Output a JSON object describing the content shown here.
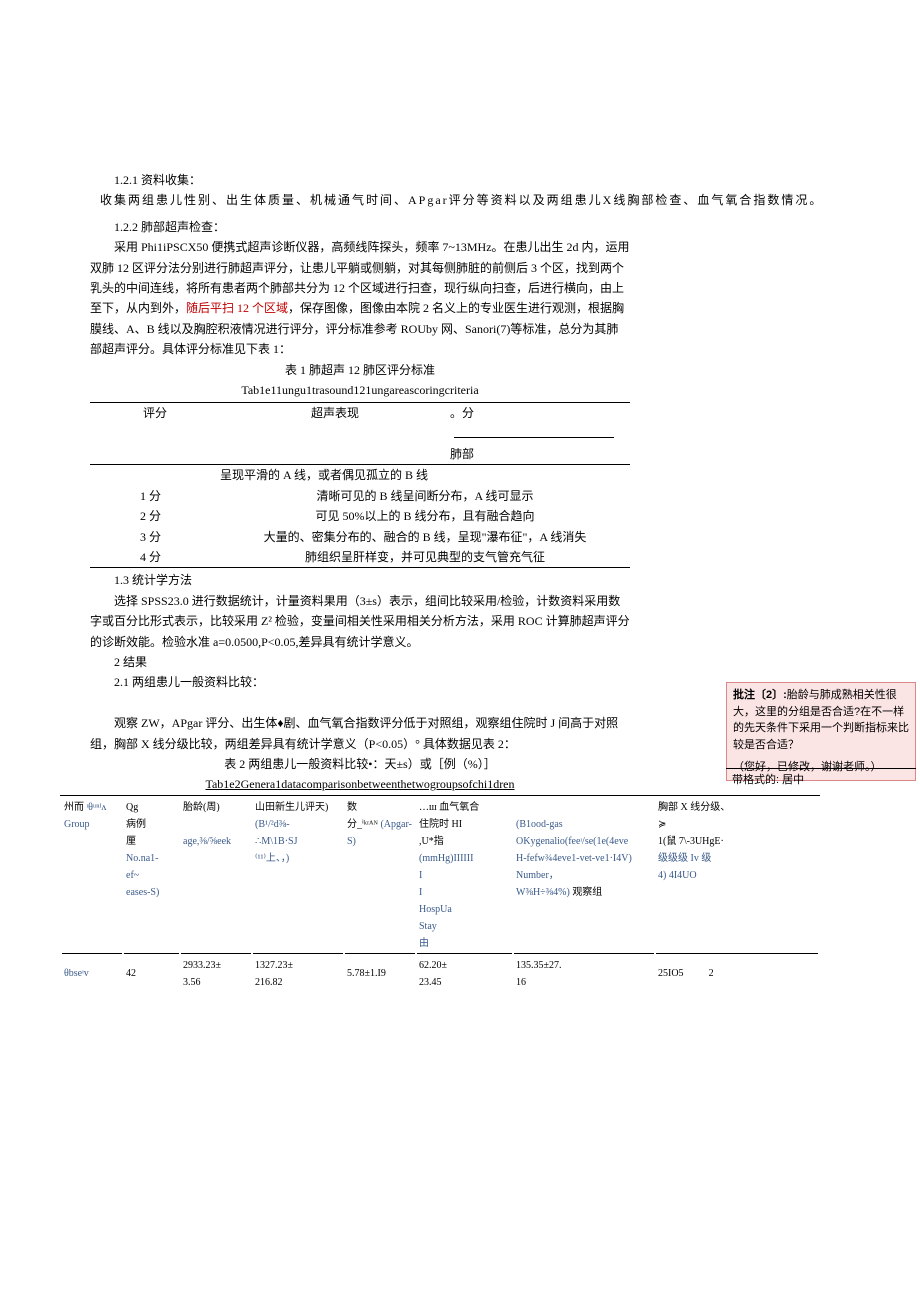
{
  "section_121_title": "1.2.1 资料收集：",
  "wide_line": "收集两组患儿性别、出生体质量、机械通气时间、APgar评分等资料以及两组患儿X线胸部检查、血气氧合指数情况。",
  "section_122_title": "1.2.2 肺部超声检查：",
  "p122_a": "采用 Phi1iPSCX50 便携式超声诊断仪器，高频线阵探头，频率 7~13MHz。在患儿出生 2d 内，运用双肺 12 区评分法分别进行肺超声评分，让患儿平躺或侧躺，对其每侧肺脏的前侧后 3 个区，找到两个乳头的中间连线，将所有患者两个肺部共分为 12 个区域进行扫查，现行纵向扫查，后进行横向，由上至下，从内到外，",
  "p122_red": "随后平扫 12 个区域",
  "p122_b": "，保存图像，图像由本院 2 名义上的专业医生进行观测，根据胸膜线、A、B 线以及胸腔积液情况进行评分，评分标准参考 ROUby 网、Sanori(7)等标准，总分为其肺部超声评分。具体评分标准见下表 1：",
  "table1_caption_cn": "表 1 肺超声 12 肺区评分标准",
  "table1_caption_en": "Tab1e11ungu1trasound121ungareascoringcriteria",
  "table1_h1": "评分",
  "table1_h2": "超声表现",
  "table1_h3a": "。分",
  "table1_h3b": "肺部",
  "table1_r0": "呈现平滑的 A 线，或者偶见孤立的 B 线",
  "table1_r1_s": "1 分",
  "table1_r1_t": "清晰可见的 B 线呈间断分布，A 线可显示",
  "table1_r2_s": "2 分",
  "table1_r2_t": "可见 50%以上的 B 线分布，且有融合趋向",
  "table1_r3_s": "3 分",
  "table1_r3_t": "大量的、密集分布的、融合的 B 线，呈现\"瀑布征\"，A 线消失",
  "table1_r4_s": "4 分",
  "table1_r4_t": "肺组织呈肝样变，并可见典型的支气管充气征",
  "section_13_title": "1.3 统计学方法",
  "p13": "选择 SPSS23.0 进行数据统计，计量资料果用（3±s）表示，组间比较采用/检验，计数资料采用数字或百分比形式表示，比较采用 Z² 检验，变量间相关性采用相关分析方法，采用 ROC 计算肺超声评分的诊断效能。检验水准 a=0.0500,P<0.05,差异具有统计学意义。",
  "section_2_title": "2 结果",
  "section_21_title": "2.1 两组患儿一般资料比较：",
  "p21_a": "观察 ZW，APgar 评分、出生体♦剧、血气氧合指数评分低于对照组，观察组住院时 J 间高于对照组，胸部 X 线分级比较，两组差异具有统计学意义（P<0.05）° 具体数据见表 2：",
  "table2_caption_cn": "表 2 两组患儿一般资料比较•：天±s）或［例（%）］",
  "table2_caption_en": "Tab1e2Genera1datacomparisonbetweenthetwogroupsofchi1dren",
  "t2": {
    "h_group_cn": "州而",
    "h_group_en": "Group",
    "h_group_sub": "ᶦθᵘⁿᴵᴧ",
    "h_n_cn": "Qg\n病例\n厘",
    "h_n_en": "No.na1-\nef~\neases-S)",
    "h_ga_cn": "胎龄(周)",
    "h_ga_en": "age,⅜/⅝eek",
    "h_bw_cn": "山田新生儿评天)",
    "h_bw_en": "(B¹/²d⅜-\n∴M\\1B·SJ\n⁽¹¹⁾上、，)",
    "h_apgar_cn": "数\n分_ⁱᵏʳᴬᴺ",
    "h_apgar_en": "(Apgar-\nS)",
    "h_hosp_cn": "…ш 血气氧合\n住院时 HI\n,U*指",
    "h_hosp_en": "(mmHg)IIIIII\nI\nI\nHospUa\nStay\n由",
    "h_ox_en": "(B1ood-gas\nOKygenalio(feeᶦ/se(1e(4eve\nH-fefw¾4eve1-vet-ve1·I4V)\nNumber，\nW⅜H÷⅜4%)",
    "h_x_cn": "胸部 X 线分级、\n≽\n1(鼠 7\\-3UHgE·",
    "h_x_en": "级级级 Iv 级\n4)    4I4UO",
    "obs_label_cn": "θbseᶦv",
    "obs_label_cn2": "观察组",
    "obs_n": "42",
    "obs_ga": "2933.23±\n3.56",
    "obs_bw": "1327.23±\n216.82",
    "obs_apgar": "5.78±1.I9",
    "obs_hosp": "62.20±\n23.45",
    "obs_ox": "135.35±27.\n16",
    "obs_x1": "25IO5",
    "obs_x2": "2"
  },
  "comment_label": "批注〔2〕:",
  "comment_body": "胎龄与肺成熟相关性很大，这里的分组是否合适?在不一样的先天条件下采用一个判断指标来比较是否合适？",
  "comment_reply": "（您好，已修改，谢谢老师。）",
  "fmtnote": "带格式的: 居中"
}
